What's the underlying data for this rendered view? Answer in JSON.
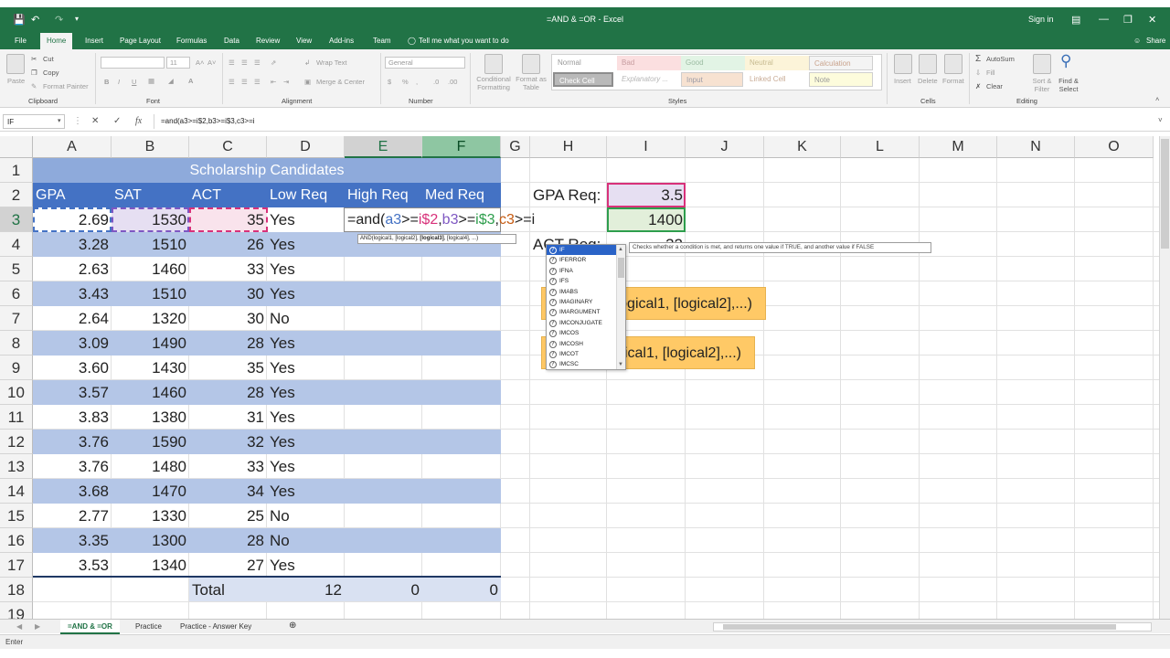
{
  "window": {
    "title": "=AND & =OR - Excel",
    "signin": "Sign in",
    "icons": [
      "save-icon",
      "undo-icon",
      "redo-icon",
      "customize-icon",
      "ribbon-options-icon",
      "minimize-icon",
      "restore-icon",
      "close-icon"
    ]
  },
  "ribbon_tabs": [
    "File",
    "Home",
    "Insert",
    "Page Layout",
    "Formulas",
    "Data",
    "Review",
    "View",
    "Add-ins",
    "Team"
  ],
  "tell_me": "Tell me what you want to do",
  "share": "Share",
  "ribbon": {
    "paste": "Paste",
    "cut": "Cut",
    "copy": "Copy",
    "format_painter": "Format Painter",
    "clipboard": "Clipboard",
    "font_size": "11",
    "bold": "B",
    "italic": "I",
    "underline": "U",
    "font": "Font",
    "wrap_text": "Wrap Text",
    "merge_center": "Merge & Center",
    "alignment": "Alignment",
    "number_format": "General",
    "number": "Number",
    "conditional_formatting": "Conditional Formatting",
    "format_as_table": "Format as Table",
    "styles_group": "Styles",
    "styles": [
      "Normal",
      "Bad",
      "Good",
      "Neutral",
      "Calculation",
      "Check Cell",
      "Explanatory ...",
      "Input",
      "Linked Cell",
      "Note"
    ],
    "insert": "Insert",
    "delete": "Delete",
    "format": "Format",
    "cells": "Cells",
    "autosum": "AutoSum",
    "fill": "Fill",
    "clear": "Clear",
    "sort_filter": "Sort & Filter",
    "find_select": "Find & Select",
    "editing": "Editing"
  },
  "formula_bar": {
    "name_box": "IF",
    "formula": "=and(a3>=i$2,b3>=i$3,c3>=i",
    "cancel": "✕",
    "enter": "✓",
    "fx": "fx"
  },
  "columns": [
    "A",
    "B",
    "C",
    "D",
    "E",
    "F",
    "G",
    "H",
    "I",
    "J",
    "K",
    "L",
    "M",
    "N",
    "O"
  ],
  "rows": [
    "1",
    "2",
    "3",
    "4",
    "5",
    "6",
    "7",
    "8",
    "9",
    "10",
    "11",
    "12",
    "13",
    "14",
    "15",
    "16",
    "17",
    "18",
    "19"
  ],
  "sheet": {
    "title": "Scholarship Candidates",
    "headers": [
      "GPA",
      "SAT",
      "ACT",
      "Low Req",
      "High Req",
      "Med Req"
    ],
    "data": [
      [
        "2.69",
        "1530",
        "35",
        "Yes"
      ],
      [
        "3.28",
        "1510",
        "26",
        "Yes"
      ],
      [
        "2.63",
        "1460",
        "33",
        "Yes"
      ],
      [
        "3.43",
        "1510",
        "30",
        "Yes"
      ],
      [
        "2.64",
        "1320",
        "30",
        "No"
      ],
      [
        "3.09",
        "1490",
        "28",
        "Yes"
      ],
      [
        "3.60",
        "1430",
        "35",
        "Yes"
      ],
      [
        "3.57",
        "1460",
        "28",
        "Yes"
      ],
      [
        "3.83",
        "1380",
        "31",
        "Yes"
      ],
      [
        "3.76",
        "1590",
        "32",
        "Yes"
      ],
      [
        "3.76",
        "1480",
        "33",
        "Yes"
      ],
      [
        "3.68",
        "1470",
        "34",
        "Yes"
      ],
      [
        "2.77",
        "1330",
        "25",
        "No"
      ],
      [
        "3.35",
        "1300",
        "28",
        "No"
      ],
      [
        "3.53",
        "1340",
        "27",
        "Yes"
      ]
    ],
    "total_label": "Total",
    "totals": [
      "12",
      "0",
      "0"
    ],
    "editing_formula_parts": [
      "=and(",
      "a3",
      ">=",
      "i$2",
      ",",
      "b3",
      ">=",
      "i$3",
      ",",
      "c3",
      ">=i"
    ],
    "gpa_req_label": "GPA Req:",
    "gpa_req_value": "3.5",
    "sat_req_value": "1400",
    "act_req_label": "ACT Req:",
    "act_req_value": "32",
    "note1": "=AND(logical1, [logical2],...)",
    "note2": "=OR(logical1, [logical2],...)"
  },
  "tooltips": {
    "arg_hint_plain1": "AND(logical1, [logical2], ",
    "arg_hint_bold": "[logical3]",
    "arg_hint_plain2": ", [logical4], ...)",
    "function_description": "Checks whether a condition is met, and returns one value if TRUE, and another value if FALSE"
  },
  "autocomplete": [
    "IF",
    "IFERROR",
    "IFNA",
    "IFS",
    "IMABS",
    "IMAGINARY",
    "IMARGUMENT",
    "IMCONJUGATE",
    "IMCOS",
    "IMCOSH",
    "IMCOT",
    "IMCSC"
  ],
  "sheet_tabs": [
    "=AND & =OR",
    "Practice",
    "Practice - Answer Key"
  ],
  "status": "Enter",
  "colors": {
    "excel_green": "#217346",
    "band_blue": "#b4c6e7",
    "header_blue": "#4472c4",
    "title_blue": "#8eaadb",
    "note_orange": "#ffc966",
    "pink_cell": "#f9e3ec",
    "purple_cell": "#e6dff2"
  }
}
